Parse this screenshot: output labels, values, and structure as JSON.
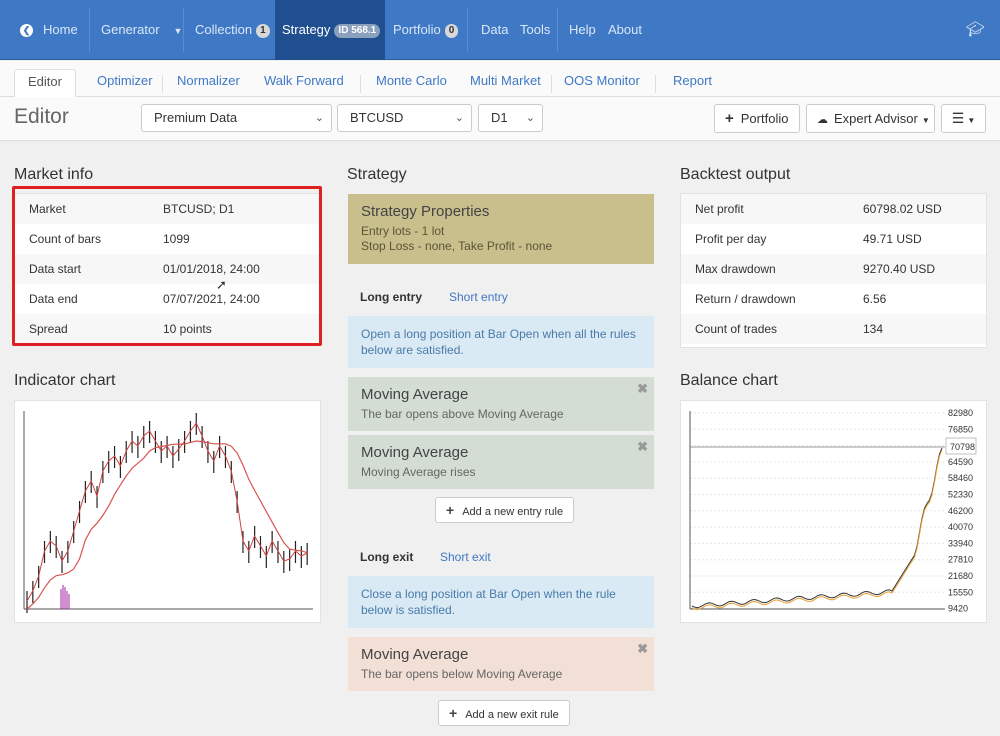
{
  "nav": {
    "home": "Home",
    "generator": "Generator",
    "collection": "Collection",
    "collection_count": "1",
    "strategy": "Strategy",
    "strategy_id": "ID 568.1",
    "portfolio": "Portfolio",
    "portfolio_count": "0",
    "data": "Data",
    "tools": "Tools",
    "help": "Help",
    "about": "About"
  },
  "tabs": [
    "Editor",
    "Optimizer",
    "Normalizer",
    "Walk Forward",
    "Monte Carlo",
    "Multi Market",
    "OOS Monitor",
    "Report"
  ],
  "toolbar": {
    "title": "Editor",
    "data_source": "Premium Data",
    "symbol": "BTCUSD",
    "period": "D1",
    "portfolio_btn": "Portfolio",
    "expert_btn": "Expert Advisor"
  },
  "market_info": {
    "title": "Market info",
    "rows": [
      {
        "k": "Market",
        "v": "BTCUSD; D1"
      },
      {
        "k": "Count of bars",
        "v": "1099"
      },
      {
        "k": "Data start",
        "v": "01/01/2018, 24:00"
      },
      {
        "k": "Data end",
        "v": "07/07/2021, 24:00"
      },
      {
        "k": "Spread",
        "v": "10 points"
      }
    ]
  },
  "indicator_chart": {
    "title": "Indicator chart"
  },
  "strategy": {
    "title": "Strategy",
    "props_title": "Strategy Properties",
    "props_line1": "Entry lots - 1 lot",
    "props_line2": "Stop Loss - none, Take Profit - none",
    "long_entry": "Long entry",
    "short_entry": "Short entry",
    "entry_info": "Open a long position at Bar Open when all the rules below are satisfied.",
    "entry_rules": [
      {
        "title": "Moving Average",
        "desc": "The bar opens above Moving Average"
      },
      {
        "title": "Moving Average",
        "desc": "Moving Average rises"
      }
    ],
    "add_entry": "Add a new entry rule",
    "long_exit": "Long exit",
    "short_exit": "Short exit",
    "exit_info": "Close a long position at Bar Open when the rule below is satisfied.",
    "exit_rule": {
      "title": "Moving Average",
      "desc": "The bar opens below Moving Average"
    },
    "add_exit": "Add a new exit rule"
  },
  "backtest": {
    "title": "Backtest output",
    "rows": [
      {
        "k": "Net profit",
        "v": "60798.02 USD"
      },
      {
        "k": "Profit per day",
        "v": "49.71 USD"
      },
      {
        "k": "Max drawdown",
        "v": "9270.40 USD"
      },
      {
        "k": "Return / drawdown",
        "v": "6.56"
      },
      {
        "k": "Count of trades",
        "v": "134"
      }
    ]
  },
  "balance_chart": {
    "title": "Balance chart",
    "ticks": [
      "82980",
      "76850",
      "70798",
      "64590",
      "58460",
      "52330",
      "46200",
      "40070",
      "33940",
      "27810",
      "21680",
      "15550",
      "9420"
    ],
    "current": "70798"
  },
  "colors": {
    "nav": "#3f78c5",
    "nav_active": "#1f4f8f",
    "highlight": "#e02020",
    "props": "#c8be8c",
    "entry_rule": "#d3ddd3",
    "exit_rule": "#f2dfd6",
    "info": "#d9eaf5"
  }
}
